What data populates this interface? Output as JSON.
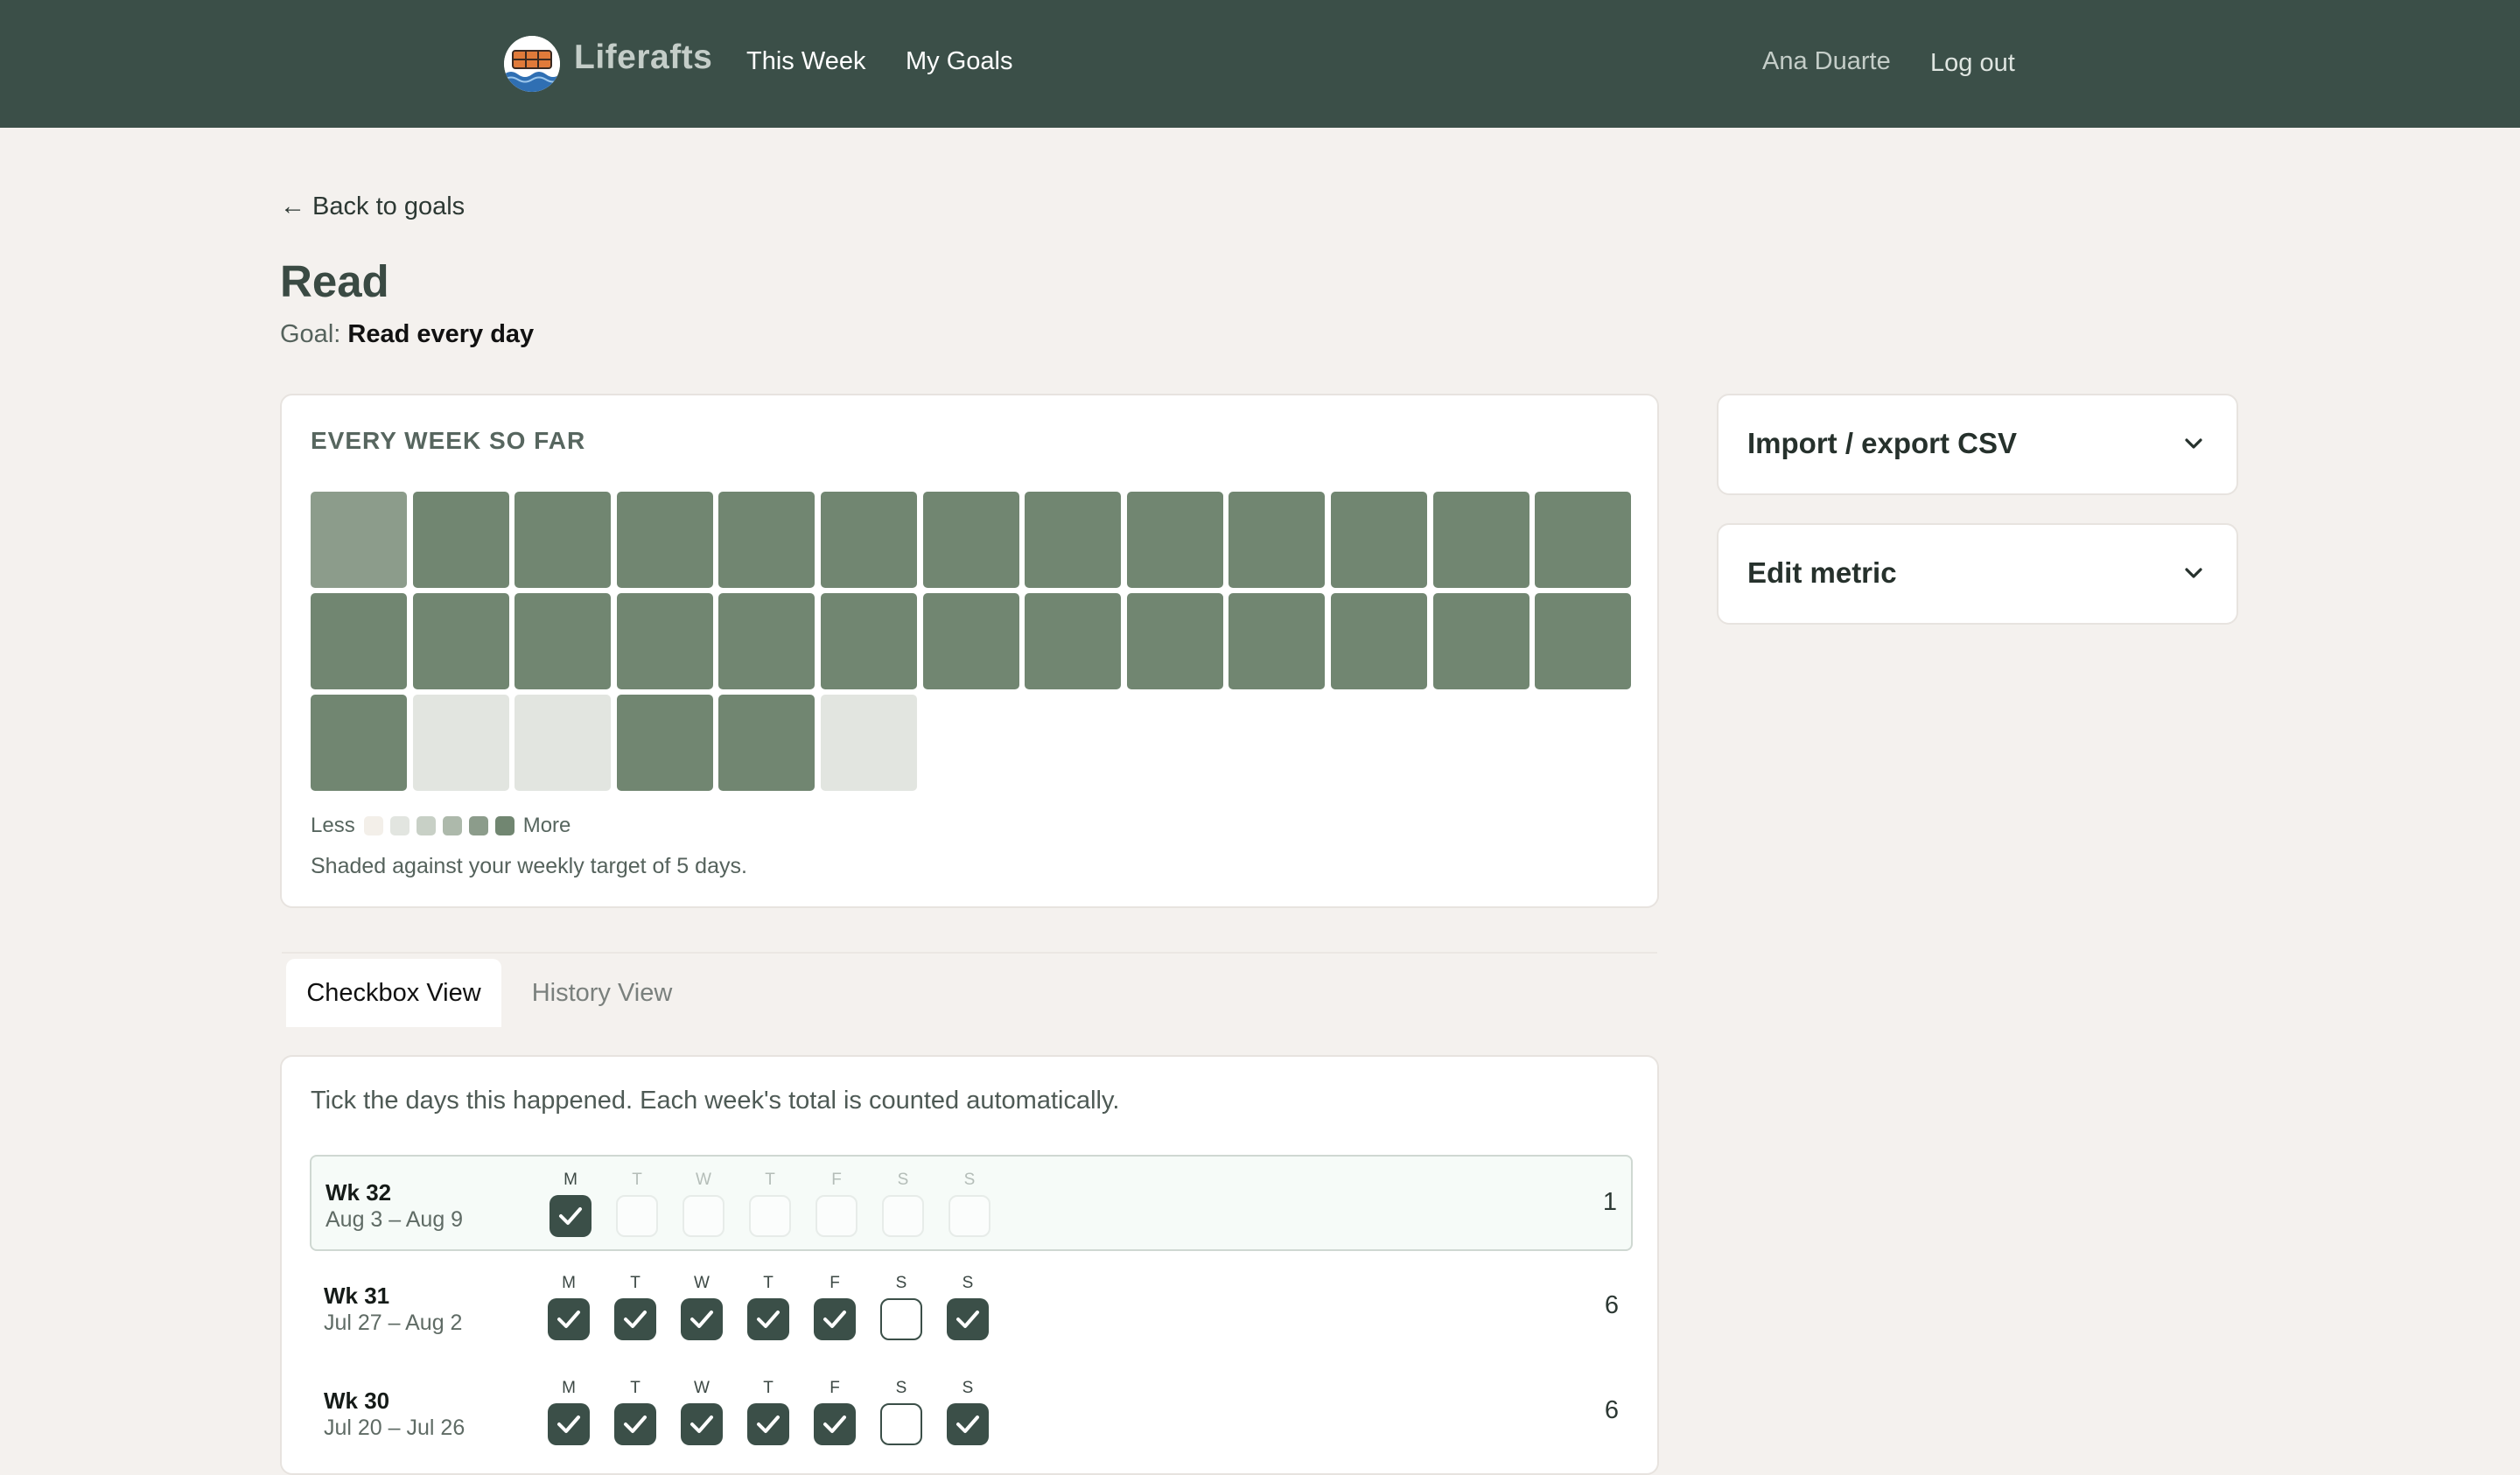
{
  "header": {
    "brand": "Liferafts",
    "nav": [
      "This Week",
      "My Goals"
    ],
    "user_name": "Ana Duarte",
    "logout_label": "Log out"
  },
  "page": {
    "back_label": "← Back to goals",
    "title": "Read",
    "goal_prefix": "Goal:",
    "goal_text": "Read every day"
  },
  "heatmap": {
    "heading": "EVERY WEEK SO FAR",
    "weekly_target": 5,
    "weeks_levels": [
      4,
      5,
      5,
      5,
      5,
      5,
      5,
      5,
      5,
      5,
      5,
      5,
      5,
      5,
      5,
      5,
      5,
      5,
      5,
      5,
      5,
      5,
      5,
      5,
      5,
      5,
      5,
      1,
      1,
      5,
      5,
      1
    ],
    "legend_less": "Less",
    "legend_more": "More",
    "legend_colors": [
      "#f3efe9",
      "#e2e5e0",
      "#c8d0c6",
      "#adb9ab",
      "#8c9c8b",
      "#718671"
    ],
    "note": "Shaded against your weekly target of 5 days."
  },
  "sidebar": {
    "panels": [
      {
        "label": "Import / export CSV"
      },
      {
        "label": "Edit metric"
      }
    ]
  },
  "tabs": [
    {
      "label": "Checkbox View",
      "active": true
    },
    {
      "label": "History View",
      "active": false
    }
  ],
  "checkbox_view": {
    "instructions": "Tick the days this happened. Each week's total is counted automatically.",
    "day_letters": [
      "M",
      "T",
      "W",
      "T",
      "F",
      "S",
      "S"
    ],
    "weeks": [
      {
        "label": "Wk 32",
        "range": "Aug 3 – Aug 9",
        "days": [
          "checked",
          "future",
          "future",
          "future",
          "future",
          "future",
          "future"
        ],
        "total": "1",
        "current": true
      },
      {
        "label": "Wk 31",
        "range": "Jul 27 – Aug 2",
        "days": [
          "checked",
          "checked",
          "checked",
          "checked",
          "checked",
          "empty",
          "checked"
        ],
        "total": "6",
        "current": false
      },
      {
        "label": "Wk 30",
        "range": "Jul 20 – Jul 26",
        "days": [
          "checked",
          "checked",
          "checked",
          "checked",
          "checked",
          "empty",
          "checked"
        ],
        "total": "6",
        "current": false
      }
    ]
  },
  "colors": {
    "header_bg": "#3b4f48",
    "page_bg": "#f4f1ee",
    "accent": "#3b4f48",
    "heat_full": "#718671"
  }
}
